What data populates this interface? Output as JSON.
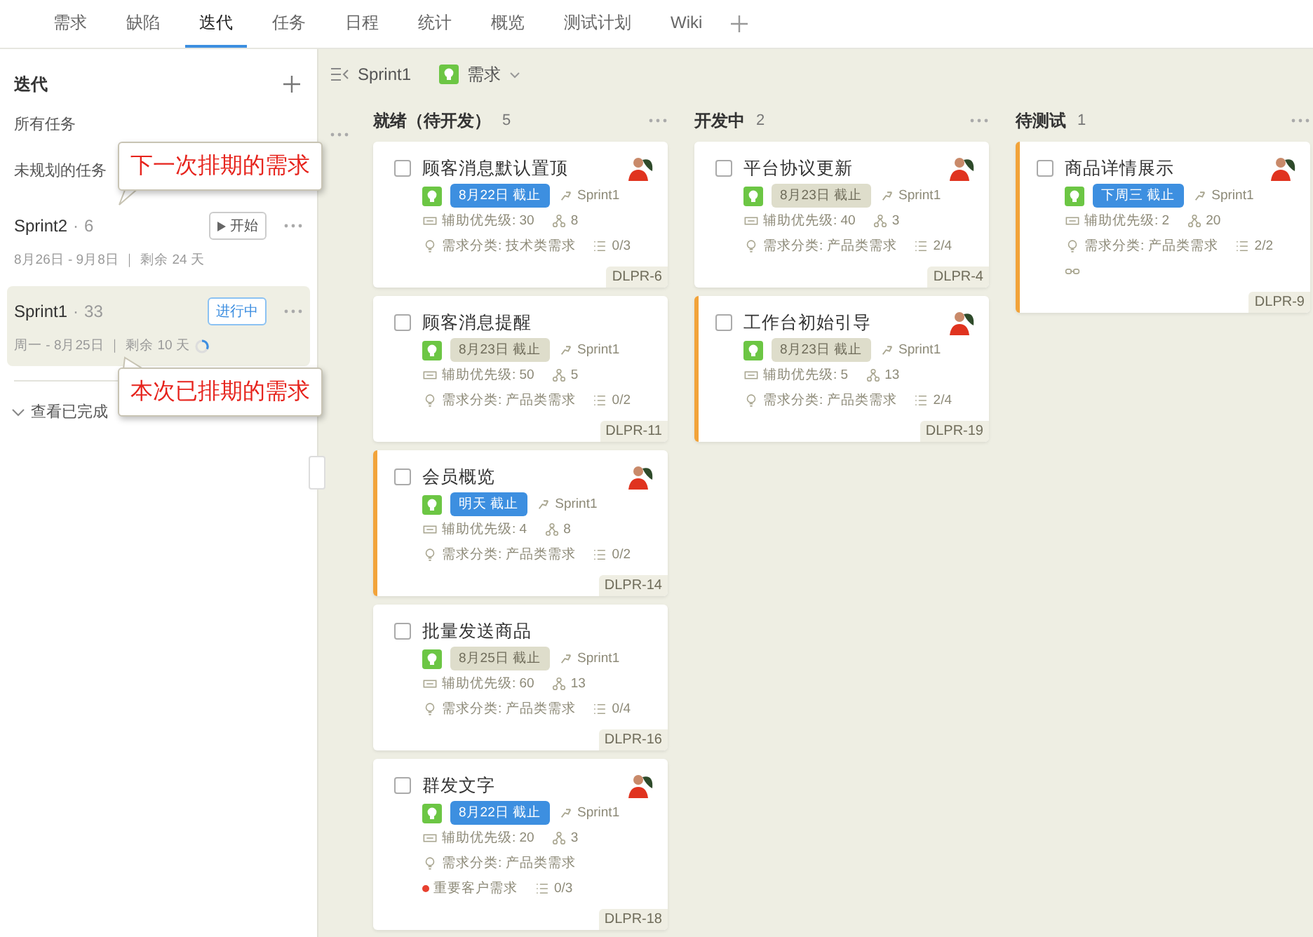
{
  "tabs": [
    {
      "label": "需求",
      "selected": false
    },
    {
      "label": "缺陷",
      "selected": false
    },
    {
      "label": "迭代",
      "selected": true
    },
    {
      "label": "任务",
      "selected": false
    },
    {
      "label": "日程",
      "selected": false
    },
    {
      "label": "统计",
      "selected": false
    },
    {
      "label": "概览",
      "selected": false
    },
    {
      "label": "测试计划",
      "selected": false
    },
    {
      "label": "Wiki",
      "selected": false
    }
  ],
  "sidebar": {
    "title": "迭代",
    "links": [
      "所有任务",
      "未规划的任务"
    ],
    "sprints": [
      {
        "name": "Sprint2",
        "separator": "·",
        "count": "6",
        "dates": "8月26日 - 9月8日 ｜ 剩余 24 天",
        "selected": false,
        "action": {
          "kind": "start",
          "label": "开始"
        },
        "progress_ring": false
      },
      {
        "name": "Sprint1",
        "separator": "·",
        "count": "33",
        "dates": "周一 - 8月25日 ｜ 剩余 10 天",
        "selected": true,
        "action": {
          "kind": "status",
          "label": "进行中"
        },
        "progress_ring": true
      }
    ],
    "show_completed": "查看已完成"
  },
  "callouts": [
    "下一次排期的需求",
    "本次已排期的需求"
  ],
  "toolbar": {
    "sprint": "Sprint1",
    "filter": "需求"
  },
  "columns": [
    {
      "name": "就绪（待开发）",
      "count": "5",
      "cards": [
        {
          "title": "顾客消息默认置顶",
          "flagged": false,
          "due": {
            "label": "8月22日 截止",
            "kind": "urgent"
          },
          "sprint": "Sprint1",
          "priority": "辅助优先级: 30",
          "members": "8",
          "category": "需求分类: 技术类需求",
          "subtasks": "0/3",
          "id": "DLPR-6",
          "assigned": true
        },
        {
          "title": "顾客消息提醒",
          "flagged": false,
          "due": {
            "label": "8月23日 截止",
            "kind": "normal"
          },
          "sprint": "Sprint1",
          "priority": "辅助优先级: 50",
          "members": "5",
          "category": "需求分类: 产品类需求",
          "subtasks": "0/2",
          "id": "DLPR-11",
          "assigned": false
        },
        {
          "title": "会员概览",
          "flagged": true,
          "due": {
            "label": "明天 截止",
            "kind": "urgent"
          },
          "sprint": "Sprint1",
          "priority": "辅助优先级: 4",
          "members": "8",
          "category": "需求分类: 产品类需求",
          "subtasks": "0/2",
          "id": "DLPR-14",
          "assigned": true
        },
        {
          "title": "批量发送商品",
          "flagged": false,
          "due": {
            "label": "8月25日 截止",
            "kind": "normal"
          },
          "sprint": "Sprint1",
          "priority": "辅助优先级: 60",
          "members": "13",
          "category": "需求分类: 产品类需求",
          "subtasks": "0/4",
          "id": "DLPR-16",
          "assigned": false
        },
        {
          "title": "群发文字",
          "flagged": false,
          "due": {
            "label": "8月22日 截止",
            "kind": "urgent"
          },
          "sprint": "Sprint1",
          "priority": "辅助优先级: 20",
          "members": "3",
          "category": "需求分类: 产品类需求",
          "tag": {
            "label": "重要客户需求",
            "color": "#e8402f"
          },
          "subtasks": "0/3",
          "id": "DLPR-18",
          "assigned": true
        }
      ]
    },
    {
      "name": "开发中",
      "count": "2",
      "cards": [
        {
          "title": "平台协议更新",
          "flagged": false,
          "due": {
            "label": "8月23日 截止",
            "kind": "normal"
          },
          "sprint": "Sprint1",
          "priority": "辅助优先级: 40",
          "members": "3",
          "category": "需求分类: 产品类需求",
          "subtasks": "2/4",
          "id": "DLPR-4",
          "assigned": true
        },
        {
          "title": "工作台初始引导",
          "flagged": true,
          "due": {
            "label": "8月23日 截止",
            "kind": "normal"
          },
          "sprint": "Sprint1",
          "priority": "辅助优先级: 5",
          "members": "13",
          "category": "需求分类: 产品类需求",
          "subtasks": "2/4",
          "id": "DLPR-19",
          "assigned": true
        }
      ]
    },
    {
      "name": "待测试",
      "count": "1",
      "cards": [
        {
          "title": "商品详情展示",
          "flagged": true,
          "due": {
            "label": "下周三 截止",
            "kind": "urgent"
          },
          "sprint": "Sprint1",
          "priority": "辅助优先级: 2",
          "members": "20",
          "category": "需求分类: 产品类需求",
          "subtasks": "2/2",
          "linked": true,
          "id": "DLPR-9",
          "assigned": true
        }
      ]
    }
  ]
}
